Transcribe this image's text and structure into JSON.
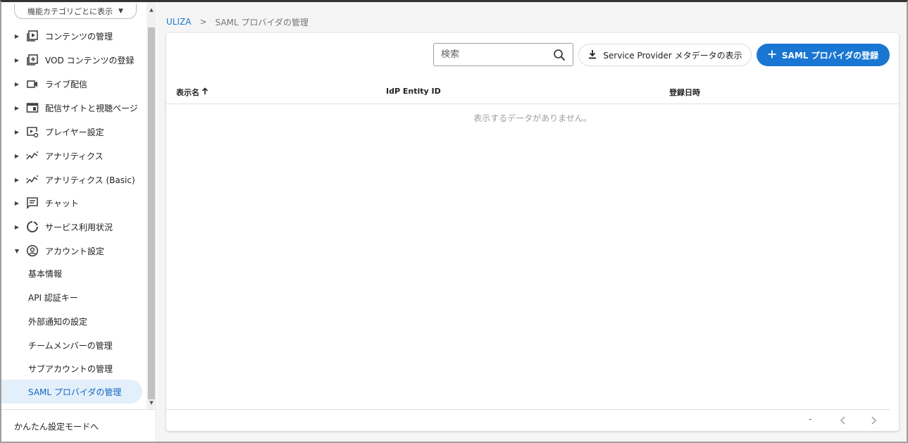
{
  "sidebar": {
    "category_select": "機能カテゴリごとに表示",
    "items": [
      {
        "label": "コンテンツの管理",
        "icon": "play-box-icon",
        "name": "sidebar-item-contents"
      },
      {
        "label": "VOD コンテンツの登録",
        "icon": "add-box-icon",
        "name": "sidebar-item-vod-register"
      },
      {
        "label": "ライブ配信",
        "icon": "video-camera-icon",
        "name": "sidebar-item-live"
      },
      {
        "label": "配信サイトと視聴ページ",
        "icon": "web-page-icon",
        "name": "sidebar-item-site"
      },
      {
        "label": "プレイヤー設定",
        "icon": "player-settings-icon",
        "name": "sidebar-item-player"
      },
      {
        "label": "アナリティクス",
        "icon": "analytics-icon",
        "name": "sidebar-item-analytics"
      },
      {
        "label": "アナリティクス (Basic)",
        "icon": "analytics-icon",
        "name": "sidebar-item-analytics-basic"
      },
      {
        "label": "チャット",
        "icon": "chat-icon",
        "name": "sidebar-item-chat"
      },
      {
        "label": "サービス利用状況",
        "icon": "donut-chart-icon",
        "name": "sidebar-item-usage"
      },
      {
        "label": "アカウント設定",
        "icon": "account-circle-icon",
        "name": "sidebar-item-account"
      }
    ],
    "sub_items": [
      {
        "label": "基本情報",
        "name": "sub-item-basic-info"
      },
      {
        "label": "API 認証キー",
        "name": "sub-item-api-key"
      },
      {
        "label": "外部通知の設定",
        "name": "sub-item-notification"
      },
      {
        "label": "チームメンバーの管理",
        "name": "sub-item-team"
      },
      {
        "label": "サブアカウントの管理",
        "name": "sub-item-subaccount"
      },
      {
        "label": "SAML プロバイダの管理",
        "name": "sub-item-saml"
      }
    ],
    "footer": "かんたん設定モードへ"
  },
  "breadcrumb": {
    "home": "ULIZA",
    "separator": ">",
    "current": "SAML プロバイダの管理"
  },
  "toolbar": {
    "search_placeholder": "検索",
    "sp_metadata_label": "Service Provider メタデータの表示",
    "register_label": "SAML プロバイダの登録"
  },
  "table": {
    "columns": [
      "表示名",
      "IdP Entity ID",
      "登録日時"
    ],
    "empty_message": "表示するデータがありません。"
  },
  "pager": {
    "range": "-"
  },
  "colors": {
    "accent": "#1976d2",
    "active_bg": "#e3f0fb"
  }
}
